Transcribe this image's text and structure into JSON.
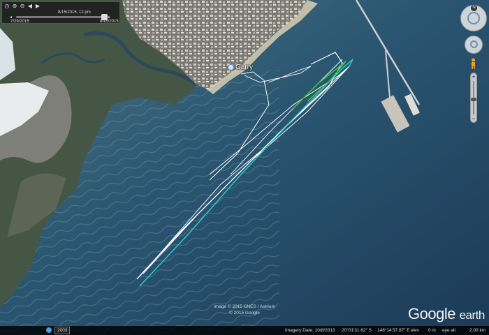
{
  "window": {
    "width": 700,
    "height": 480
  },
  "timeslider": {
    "current_time": "8/15/2015, 12 pm",
    "start_date": "7/29/2015",
    "end_date": "8/15/2015",
    "progress_fraction": 0.97,
    "icons": [
      "clock-icon",
      "zoom-in-icon",
      "zoom-out-icon",
      "back-icon",
      "forward-icon"
    ]
  },
  "navigation": {
    "compass_label": "N",
    "zoom_in_label": "+",
    "zoom_out_label": "−",
    "zoom_level_fraction": 0.45
  },
  "map": {
    "place_label": "Garry",
    "credits_line1": "Image © 2015 CNES / Astrium",
    "credits_line2": "© 2015 Google",
    "logo_google": "Google",
    "logo_earth": "earth",
    "colors": {
      "sea": "#23496a",
      "land": "#4d5a48",
      "track_white": "#ffffff",
      "track_cyan": "#2fd0c9",
      "track_green": "#39c43a"
    }
  },
  "statusbar": {
    "box_label": "2003",
    "imagery_date": "Imagery Date: 10/8/2013",
    "lat": "20°01'31.62\" S",
    "lon": "148°14'37.87\" E",
    "elev_label": "elev",
    "elev_value": "0 m",
    "eye_alt_label": "eye alt",
    "eye_alt_value": "2.00 km"
  }
}
